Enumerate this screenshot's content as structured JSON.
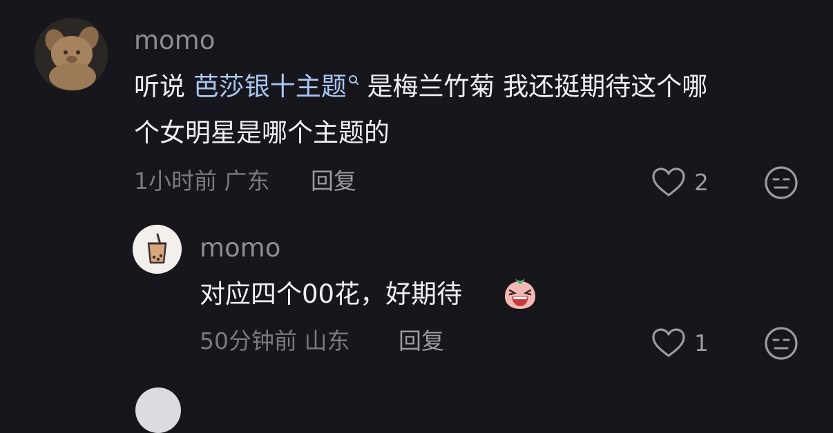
{
  "comments": [
    {
      "username": "momo",
      "text_before": "听说 ",
      "link_text": "芭莎银十主题",
      "text_after_line1": " 是梅兰竹菊 我还挺期待这个哪",
      "text_line2": "个女明星是哪个主题的",
      "time": "1小时前",
      "location": "广东",
      "reply_label": "回复",
      "like_count": "2"
    },
    {
      "username": "momo",
      "text": "对应四个00花，好期待",
      "time": "50分钟前",
      "location": "山东",
      "reply_label": "回复",
      "like_count": "1"
    }
  ],
  "icons": {
    "search": "search-icon",
    "like": "heart-outline-icon",
    "dislike": "neutral-face-icon",
    "emoji": "laughing-emoji-icon"
  },
  "colors": {
    "background": "#17161c",
    "link": "#a9c7f3",
    "text": "#f0f0f4",
    "meta": "#7b7a80"
  }
}
